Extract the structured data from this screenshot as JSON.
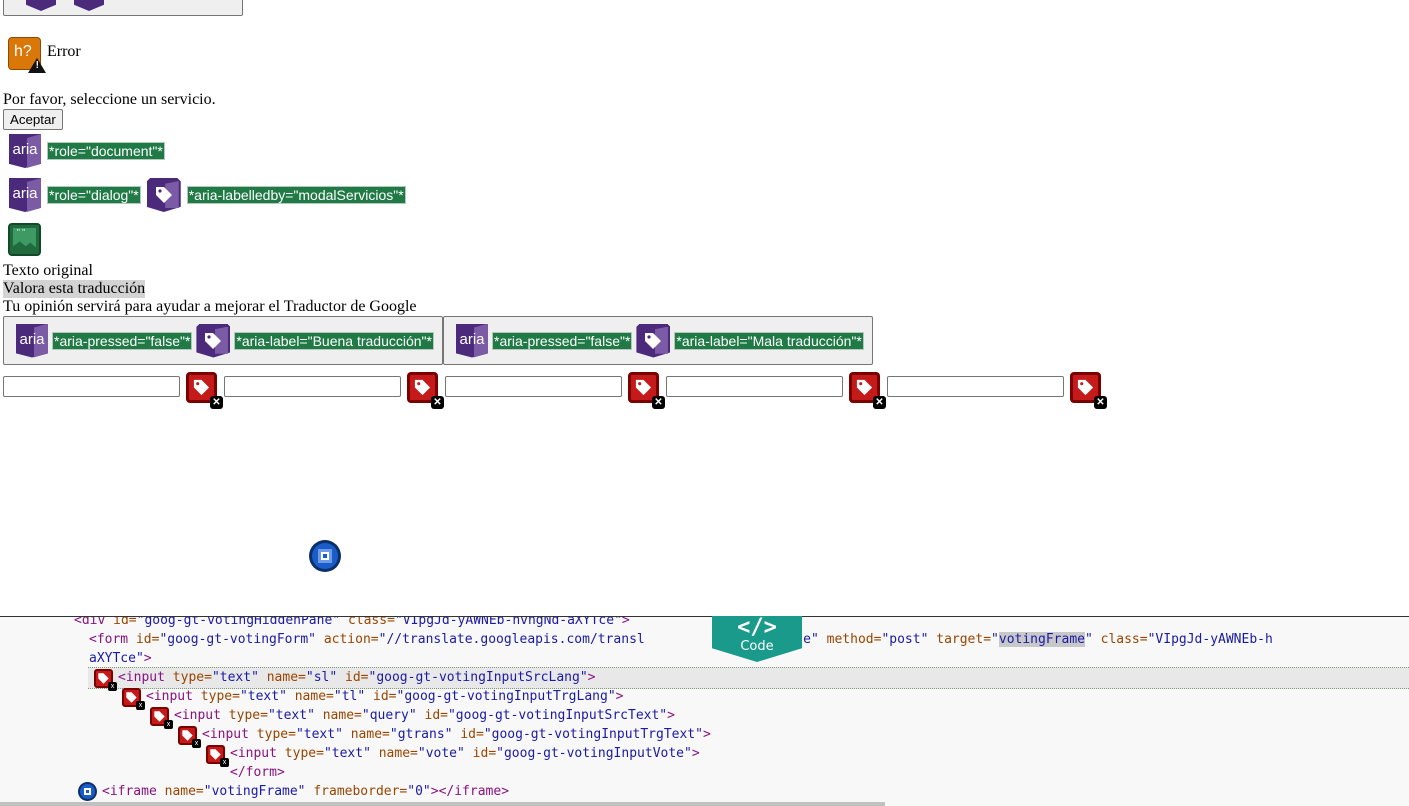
{
  "error": {
    "title": "Error",
    "message": "Por favor, seleccione un servicio.",
    "accept_label": "Aceptar",
    "icon": "help-warning-icon"
  },
  "aria_annotations": {
    "badge_text": "aria",
    "document_role": "*role=\"document\"*",
    "dialog_role": "*role=\"dialog\"*",
    "dialog_labelledby": "*aria-labelledby=\"modalServicios\"*"
  },
  "translation": {
    "original_text_label": "Texto original",
    "rate_label": "Valora esta traducción",
    "feedback_note": "Tu opinión servirá para ayudar a mejorar el Traductor de Google",
    "good_button": {
      "pressed": "*aria-pressed=\"false\"*",
      "label": "*aria-label=\"Buena traducción\"*"
    },
    "bad_button": {
      "pressed": "*aria-pressed=\"false\"*",
      "label": "*aria-label=\"Mala traducción\"*"
    }
  },
  "inputs": [
    {
      "value": "",
      "placeholder": ""
    },
    {
      "value": "",
      "placeholder": ""
    },
    {
      "value": "",
      "placeholder": ""
    },
    {
      "value": "",
      "placeholder": ""
    },
    {
      "value": "",
      "placeholder": ""
    }
  ],
  "code_badge": {
    "symbol": "</>",
    "label": "Code"
  },
  "code": {
    "line0": {
      "open": "<div ",
      "a1": "id=",
      "v1": "\"goog-gt-votingHiddenPane\"",
      "a2": " class=",
      "v2": "\"VIpgJd-yAWNEb-hvhgNd-aXYTce\"",
      "close": ">"
    },
    "line1": {
      "open": "<form ",
      "a1": "id=",
      "v1": "\"goog-gt-votingForm\"",
      "a2": " action=",
      "v2": "\"//translate.googleapis.com/transl",
      "v2b": "?client=te\"",
      "a3": " method=",
      "v3": "\"post\"",
      "a4": " target=",
      "v4q1": "\"",
      "v4": "votingFrame",
      "v4q2": "\"",
      "a5": " class=",
      "v5": "\"VIpgJd-yAWNEb-h"
    },
    "line1b": {
      "v5": "aXYTce\"",
      "close": ">"
    },
    "inputs": [
      {
        "name": "\"sl\"",
        "id": "\"goog-gt-votingInputSrcLang\""
      },
      {
        "name": "\"tl\"",
        "id": "\"goog-gt-votingInputTrgLang\""
      },
      {
        "name": "\"query\"",
        "id": "\"goog-gt-votingInputSrcText\""
      },
      {
        "name": "\"gtrans\"",
        "id": "\"goog-gt-votingInputTrgText\""
      },
      {
        "name": "\"vote\"",
        "id": "\"goog-gt-votingInputVote\""
      }
    ],
    "input_tag": "<input ",
    "type_attr": "type=",
    "type_val": "\"text\"",
    "name_attr": " name=",
    "id_attr": " id=",
    "tag_close": ">",
    "form_close": "</form>",
    "iframe": {
      "open": "<iframe ",
      "a1": "name=",
      "v1": "\"votingFrame\"",
      "a2": " frameborder=",
      "v2": "\"0\"",
      "close": "></iframe>"
    }
  }
}
